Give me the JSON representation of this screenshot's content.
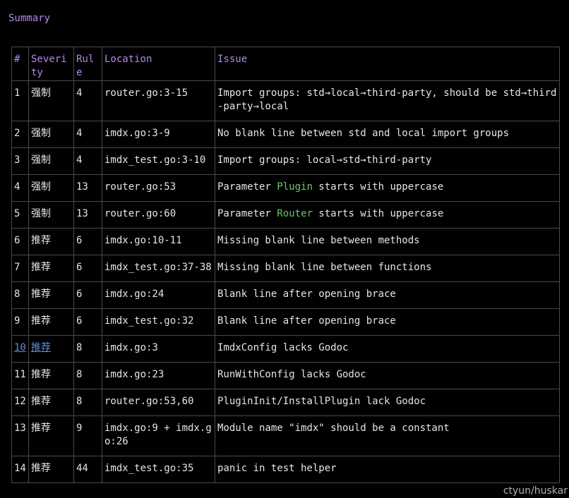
{
  "title": "Summary",
  "table": {
    "headers": [
      "#",
      "Severity",
      "Rule",
      "Location",
      "Issue"
    ],
    "rows": [
      {
        "num": "1",
        "severity": "强制",
        "rule": "4",
        "location": "router.go:3-15",
        "issue": "Import groups: std→local→third-party, should be std→third-party→local"
      },
      {
        "num": "2",
        "severity": "强制",
        "rule": "4",
        "location": "imdx.go:3-9",
        "issue": "No blank line between std and local import groups"
      },
      {
        "num": "3",
        "severity": "强制",
        "rule": "4",
        "location": "imdx_test.go:3-10",
        "issue": "Import groups: local→std→third-party"
      },
      {
        "num": "4",
        "severity": "强制",
        "rule": "13",
        "location": "router.go:53",
        "issue_pre": "Parameter ",
        "issue_ident": "Plugin",
        "issue_post": " starts with uppercase"
      },
      {
        "num": "5",
        "severity": "强制",
        "rule": "13",
        "location": "router.go:60",
        "issue_pre": "Parameter ",
        "issue_ident": "Router",
        "issue_post": " starts with uppercase"
      },
      {
        "num": "6",
        "severity": "推荐",
        "rule": "6",
        "location": "imdx.go:10-11",
        "issue": "Missing blank line between methods"
      },
      {
        "num": "7",
        "severity": "推荐",
        "rule": "6",
        "location": "imdx_test.go:37-38",
        "issue": "Missing blank line between functions"
      },
      {
        "num": "8",
        "severity": "推荐",
        "rule": "6",
        "location": "imdx.go:24",
        "issue": "Blank line after opening brace"
      },
      {
        "num": "9",
        "severity": "推荐",
        "rule": "6",
        "location": "imdx_test.go:32",
        "issue": "Blank line after opening brace"
      },
      {
        "num": "10",
        "severity": "推荐",
        "rule": "8",
        "location": "imdx.go:3",
        "issue": "ImdxConfig lacks Godoc"
      },
      {
        "num": "11",
        "severity": "推荐",
        "rule": "8",
        "location": "imdx.go:23",
        "issue": "RunWithConfig lacks Godoc"
      },
      {
        "num": "12",
        "severity": "推荐",
        "rule": "8",
        "location": "router.go:53,60",
        "issue": "PluginInit/InstallPlugin lack Godoc"
      },
      {
        "num": "13",
        "severity": "推荐",
        "rule": "9",
        "location": "imdx.go:9 + imdx.go:26",
        "issue": "Module name \"imdx\" should be a constant"
      },
      {
        "num": "14",
        "severity": "推荐",
        "rule": "44",
        "location": "imdx_test.go:35",
        "issue": "panic in test helper"
      }
    ]
  },
  "watermark": "ctyun/huskar",
  "colors": {
    "heading": "#b388e8",
    "identifier": "#6cc76c",
    "link": "#5b8fd9",
    "border": "#4a4a4a",
    "background": "#000000"
  }
}
